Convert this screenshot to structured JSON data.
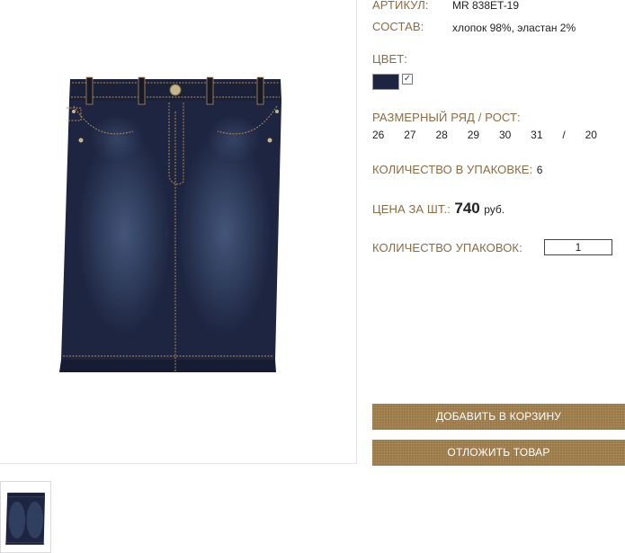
{
  "product": {
    "article_label": "АРТИКУЛ:",
    "article_value": "MR 838ET-19",
    "composition_label": "СОСТАВ:",
    "composition_value": "хлопок 98%, эластан 2%",
    "color_label": "ЦВЕТ:",
    "color_swatch": "#1d2540",
    "color_check": "✓",
    "size_label": "РАЗМЕРНЫЙ РЯД / РОСТ:",
    "sizes": [
      "26",
      "27",
      "28",
      "29",
      "30",
      "31",
      "/",
      "20"
    ],
    "pack_qty_label": "КОЛИЧЕСТВО В УПАКОВКЕ:",
    "pack_qty_value": "6",
    "price_label": "ЦЕНА ЗА ШТ.:",
    "price_value": "740",
    "price_currency": "руб.",
    "packs_label": "КОЛИЧЕСТВО УПАКОВОК:",
    "packs_value": "1"
  },
  "actions": {
    "add_to_cart": "ДОБАВИТЬ В КОРЗИНУ",
    "postpone": "ОТЛОЖИТЬ ТОВАР"
  },
  "colors": {
    "accent": "#9b7a47",
    "label": "#8c6b43",
    "denim": "#1d2540"
  }
}
